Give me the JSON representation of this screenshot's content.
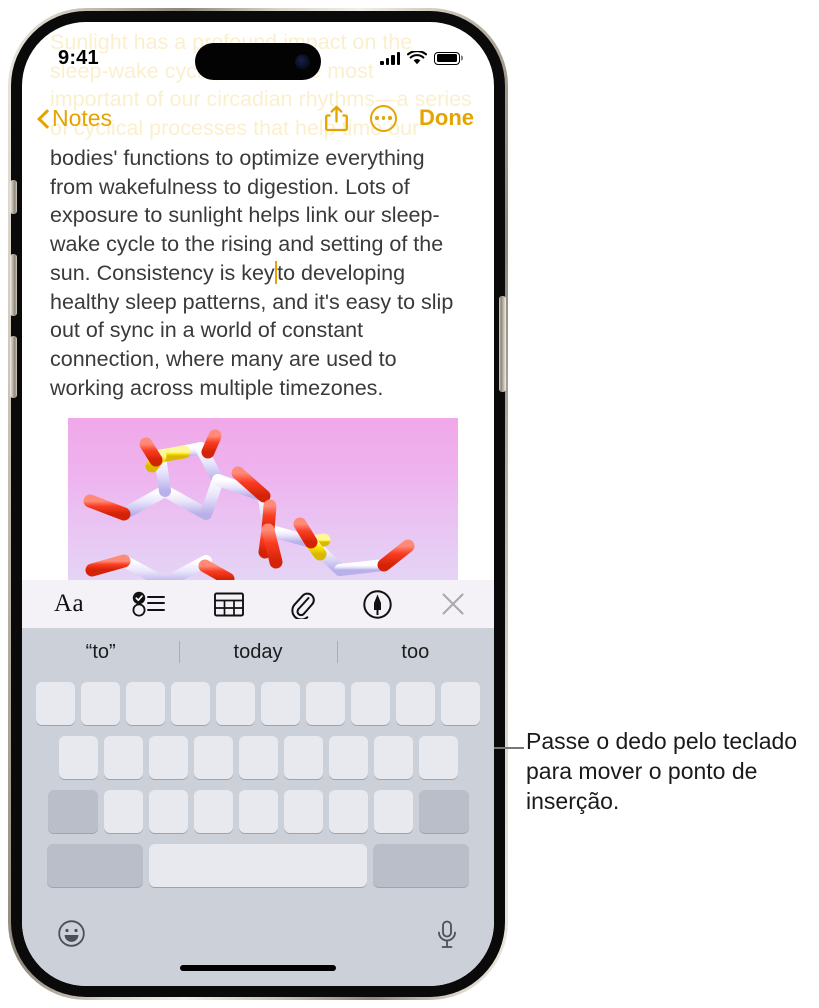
{
  "device": {
    "frame": "iphone",
    "buttons": [
      "action-button",
      "volume-up-button",
      "volume-down-button",
      "power-button"
    ]
  },
  "status_bar": {
    "time": "9:41",
    "cellular_icon": "signal-bars-icon",
    "wifi_icon": "wifi-icon",
    "battery_icon": "battery-icon"
  },
  "nav_bar": {
    "back_label": "Notes",
    "back_icon": "chevron-left-icon",
    "share_icon": "share-icon",
    "more_icon": "ellipsis-circle-icon",
    "done_label": "Done",
    "accent_color": "#E5A400"
  },
  "note": {
    "scrolled_off_text": "Sunlight has a profound impact on the\nsleep-wake cycle, one of the most\nimportant of our circadian rhythms—a series\nof cyclical processes that help time our",
    "body_before_caret": "bodies' functions to optimize everything from wakefulness to digestion. Lots of exposure to sunlight helps link our sleep-wake cycle to the rising and setting of the sun. Consistency is key",
    "body_after_caret": "to developing healthy sleep patterns, and it's easy to slip out of sync in a world of constant connection, where many are used to working across multiple timezones.",
    "text_color": "#3a3a3a",
    "caret_color": "#E5A400",
    "attachment": {
      "name": "molecule-image",
      "description": "3D ball-and-stick molecular model",
      "background_top_color": "#f0a8e8",
      "background_bottom_color": "#e4d4f5"
    }
  },
  "format_toolbar": {
    "background_color": "#f4f2f7",
    "items": [
      {
        "name": "format-text-button",
        "icon": "aa-icon",
        "label": "Aa"
      },
      {
        "name": "checklist-button",
        "icon": "checklist-icon",
        "label": ""
      },
      {
        "name": "table-button",
        "icon": "table-icon",
        "label": ""
      },
      {
        "name": "attachment-button",
        "icon": "paperclip-icon",
        "label": ""
      },
      {
        "name": "markup-button",
        "icon": "markup-pen-icon",
        "label": ""
      },
      {
        "name": "close-toolbar-button",
        "icon": "close-x-icon",
        "label": ""
      }
    ]
  },
  "keyboard": {
    "background_color": "#ccd0d9",
    "key_color": "#e7e9ee",
    "modifier_key_color": "#b9bec9",
    "keys_blank": true,
    "predictions": [
      "“to”",
      "today",
      "too"
    ],
    "row1_key_count": 10,
    "row2_key_count": 9,
    "row3_key_count": 7,
    "shift_key": "shift-key",
    "delete_key": "delete-key",
    "numbers_key": "numbers-key",
    "space_key": "space-key",
    "return_key": "return-key",
    "emoji_icon": "emoji-smiley-icon",
    "dictation_icon": "microphone-icon"
  },
  "callout": {
    "text": "Passe o dedo pelo teclado para mover o ponto de inserção.",
    "leader_line_color": "#77777a"
  }
}
